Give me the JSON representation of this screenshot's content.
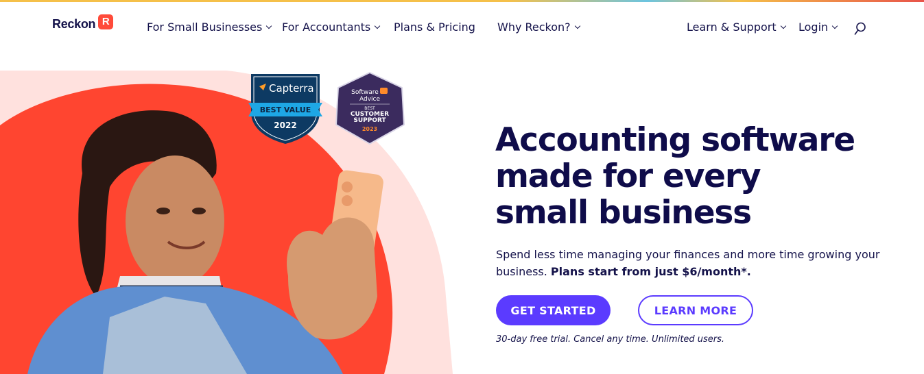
{
  "header": {
    "logo_text": "Reckon",
    "logo_mark": "R",
    "nav_left": [
      {
        "label": "For Small Businesses",
        "has_dropdown": true
      },
      {
        "label": "For Accountants",
        "has_dropdown": true
      },
      {
        "label": "Plans & Pricing",
        "has_dropdown": false
      },
      {
        "label": "Why Reckon?",
        "has_dropdown": true
      }
    ],
    "nav_right": [
      {
        "label": "Learn & Support",
        "has_dropdown": true
      },
      {
        "label": "Login",
        "has_dropdown": true
      }
    ],
    "search_icon": "search-icon"
  },
  "badges": {
    "capterra": {
      "brand": "Capterra",
      "ribbon": "BEST VALUE",
      "year": "2022"
    },
    "software_advice": {
      "brand_line1": "Software",
      "brand_line2": "Advice",
      "small": "BEST",
      "title_line1": "CUSTOMER",
      "title_line2": "SUPPORT",
      "year": "2023"
    }
  },
  "hero": {
    "headline_line1": "Accounting software",
    "headline_line2": "made for every",
    "headline_line3": "small business",
    "subcopy": "Spend less time managing your finances and more time growing your business.",
    "subcopy_bold": "Plans start from just $6/month*.",
    "primary_cta": "GET STARTED",
    "secondary_cta": "LEARN MORE",
    "trial_note": "30-day free trial. Cancel any time. Unlimited users."
  },
  "colors": {
    "brand_red": "#ff4b3a",
    "navy": "#0f0c4a",
    "purple": "#5b3bff",
    "pink_bg": "#ffd9d6"
  }
}
